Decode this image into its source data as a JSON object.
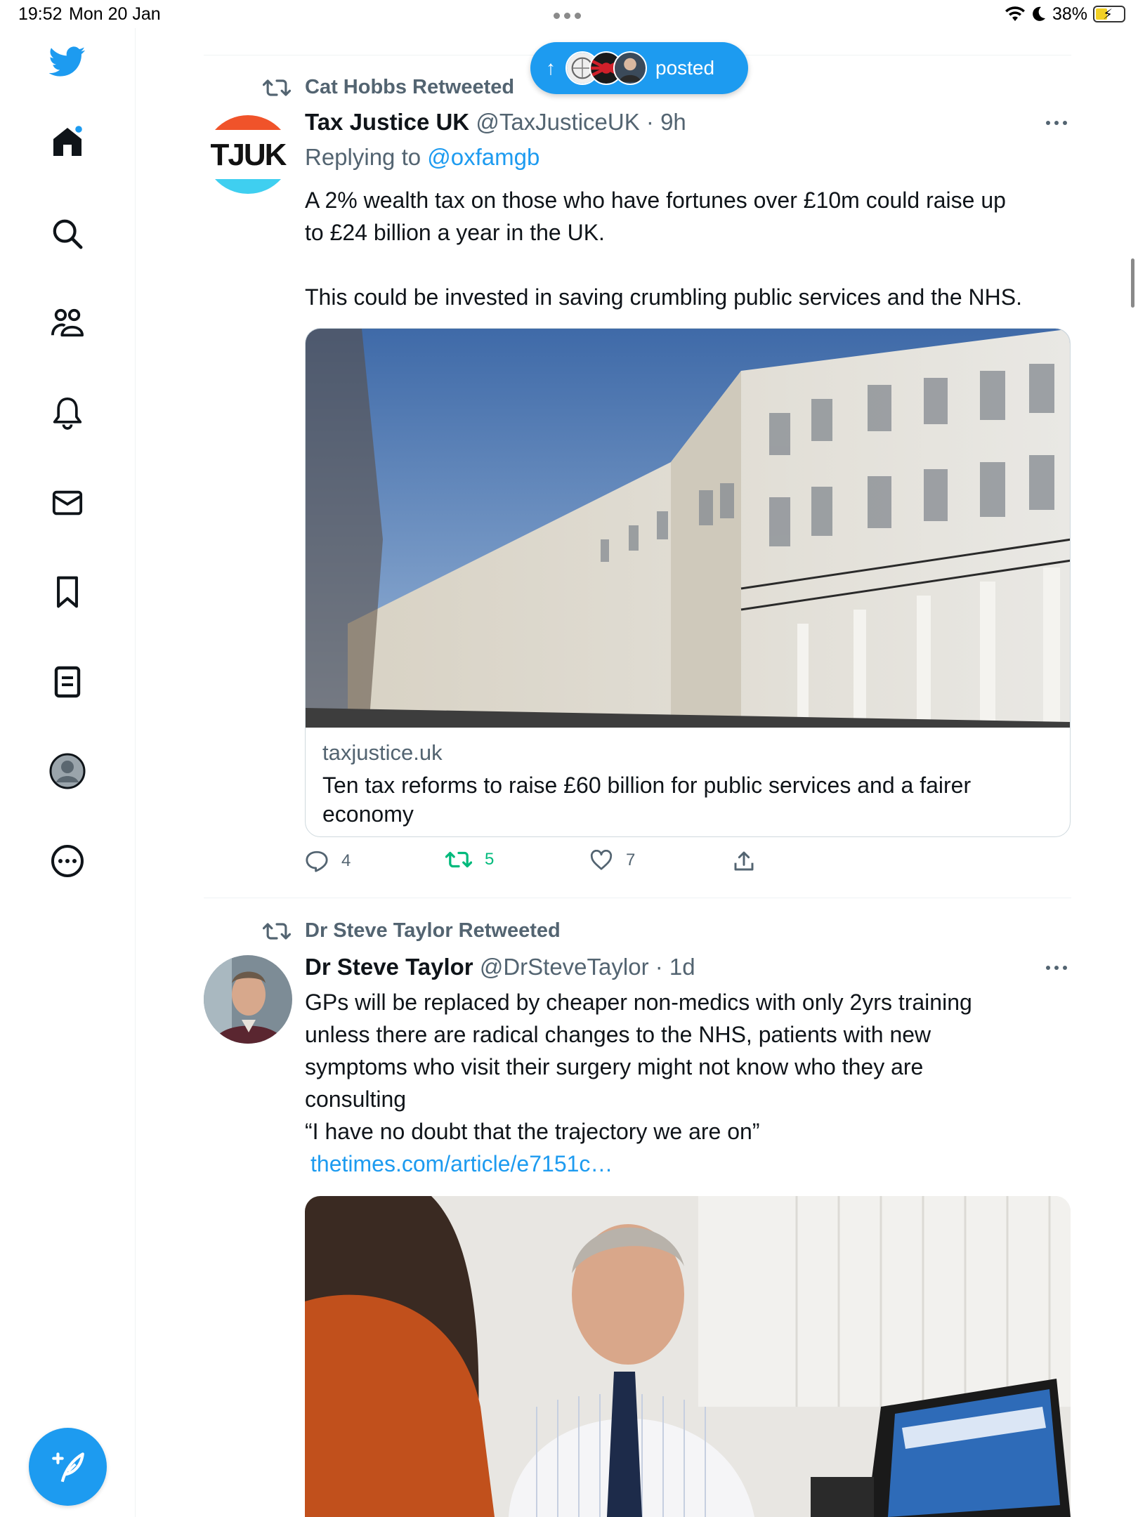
{
  "status_bar": {
    "time": "19:52",
    "date": "Mon 20 Jan",
    "battery": "38%"
  },
  "sidebar": {
    "items": [
      {
        "icon": "twitter-logo-icon"
      },
      {
        "icon": "home-icon"
      },
      {
        "icon": "search-icon"
      },
      {
        "icon": "communities-icon"
      },
      {
        "icon": "notifications-bell-icon"
      },
      {
        "icon": "messages-envelope-icon"
      },
      {
        "icon": "bookmark-icon"
      },
      {
        "icon": "lists-icon"
      },
      {
        "icon": "profile-avatar-icon"
      },
      {
        "icon": "more-circle-icon"
      }
    ],
    "compose_icon": "compose-tweet-icon"
  },
  "new_posts_pill": {
    "label": "posted"
  },
  "tweets": [
    {
      "social_context": "Cat Hobbs Retweeted",
      "name": "Tax Justice UK",
      "handle": "@TaxJusticeUK",
      "time": "9h",
      "replying_prefix": "Replying to",
      "replying_to": "@oxfamgb",
      "text_line1": "A 2% wealth tax on those who have fortunes over £10m could raise up",
      "text_line2": "to £24 billion a year in the UK.",
      "text_line3": "This could be invested in saving crumbling public services and the NHS.",
      "avatar_label": "TJUK",
      "card": {
        "domain": "taxjustice.uk",
        "title": "Ten tax reforms to raise £60 billion for public services and a fairer economy"
      },
      "stats": {
        "replies": "4",
        "retweets": "5",
        "likes": "7"
      }
    },
    {
      "social_context": "Dr Steve Taylor Retweeted",
      "name": "Dr Steve Taylor",
      "handle": "@DrSteveTaylor",
      "time": "1d",
      "text_line1": "GPs will be replaced by cheaper non-medics with only 2yrs training",
      "text_line2": "unless there are radical changes to the NHS, patients with new",
      "text_line3": "symptoms who visit their surgery might not know who they are",
      "text_line4": "consulting",
      "text_line5": "“I have no doubt that the trajectory we are on”",
      "link": "thetimes.com/article/e7151c…"
    }
  ],
  "colors": {
    "accent": "#1d9bf0",
    "retweet_green": "#00ba7c",
    "secondary_text": "#536471"
  }
}
